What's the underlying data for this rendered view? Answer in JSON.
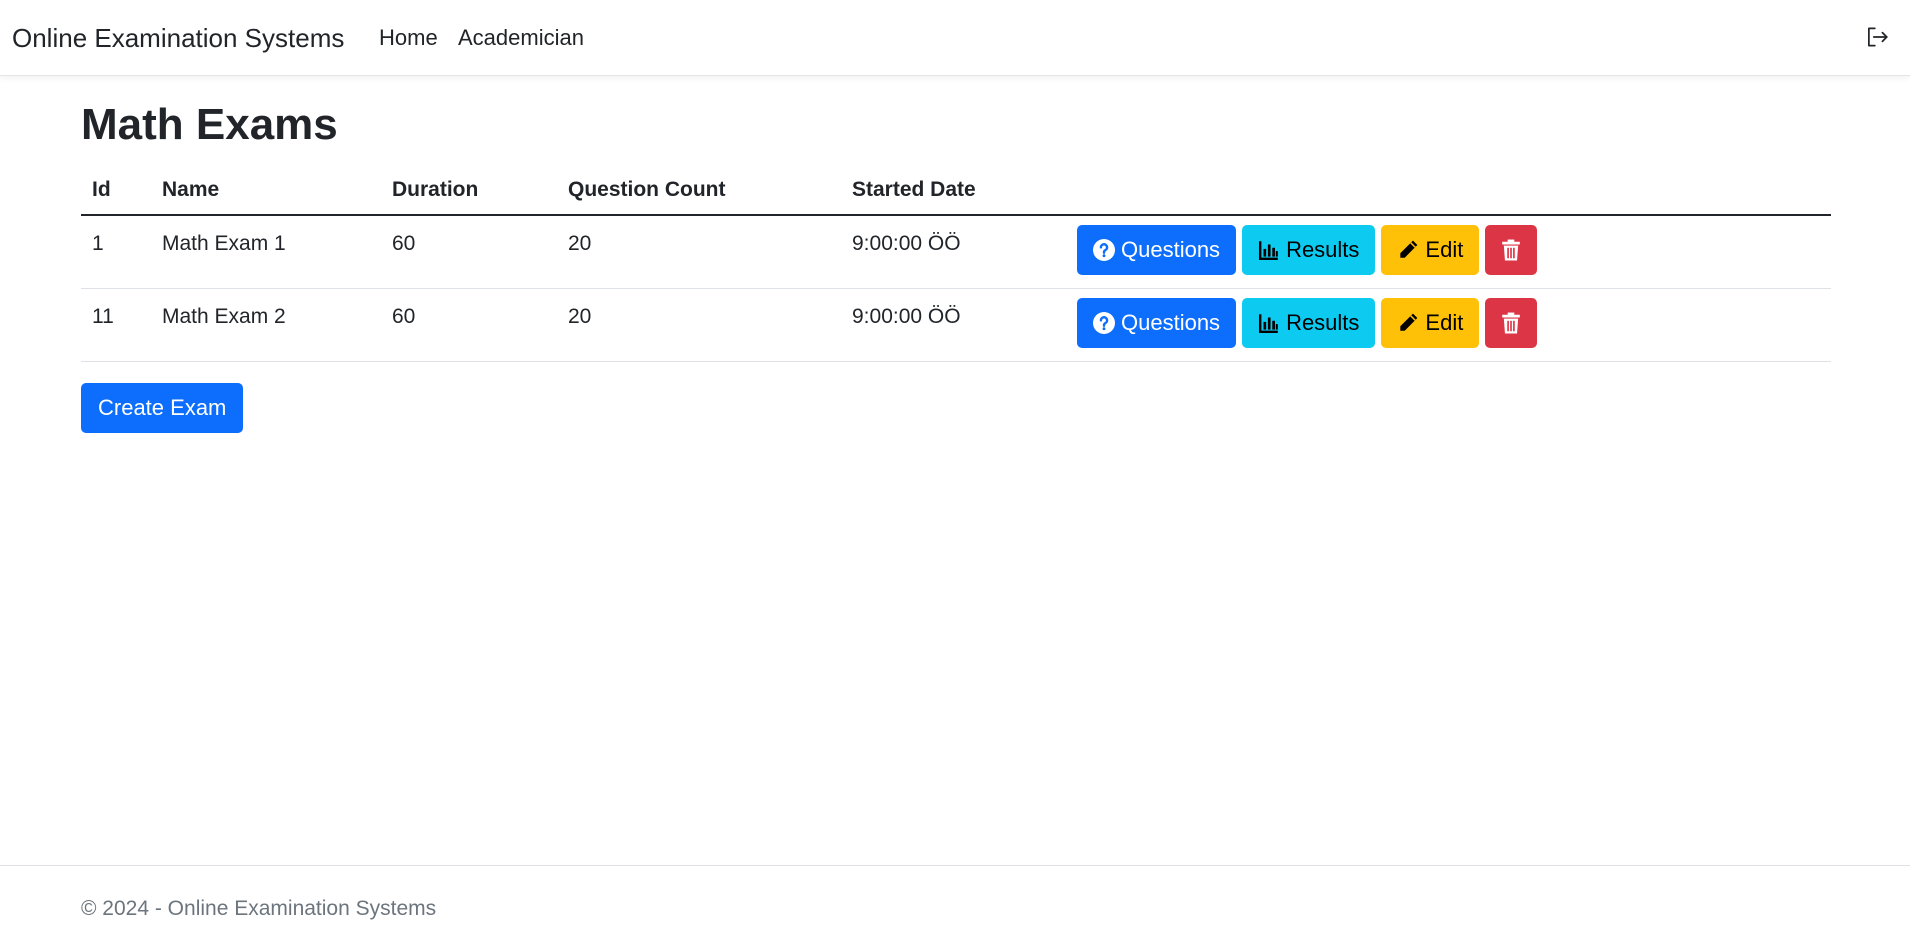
{
  "nav": {
    "brand": "Online Examination Systems",
    "links": [
      "Home",
      "Academician"
    ]
  },
  "page": {
    "title": "Math Exams"
  },
  "table": {
    "headers": [
      "Id",
      "Name",
      "Duration",
      "Question Count",
      "Started Date"
    ],
    "rows": [
      {
        "id": "1",
        "name": "Math Exam 1",
        "duration": "60",
        "question_count": "20",
        "started_date": "9:00:00 ÖÖ"
      },
      {
        "id": "11",
        "name": "Math Exam 2",
        "duration": "60",
        "question_count": "20",
        "started_date": "9:00:00 ÖÖ"
      }
    ],
    "actions": {
      "questions": "Questions",
      "results": "Results",
      "edit": "Edit"
    }
  },
  "create_button": "Create Exam",
  "footer": "© 2024 - Online Examination Systems",
  "colors": {
    "primary": "#0d6efd",
    "info": "#0dcaf0",
    "warning": "#ffc107",
    "danger": "#dc3545"
  },
  "icons": {
    "logout": "logout-icon",
    "questions": "question-circle-icon",
    "results": "bar-chart-icon",
    "edit": "pencil-icon",
    "delete": "trash-icon"
  }
}
